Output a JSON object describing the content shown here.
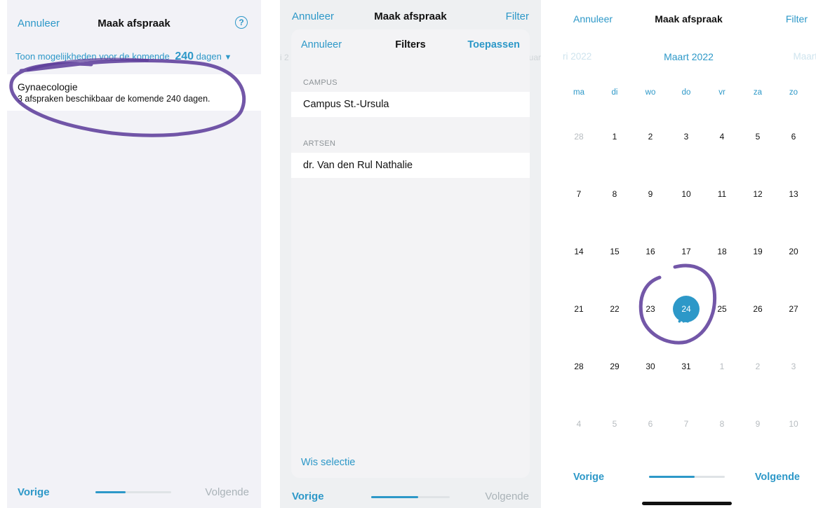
{
  "colors": {
    "accent": "#2d98c8",
    "annotation": "#5b3a99"
  },
  "screen1": {
    "nav": {
      "cancel": "Annuleer",
      "title": "Maak afspraak",
      "help_icon": "question-circle-icon",
      "help_glyph": "?"
    },
    "range": {
      "prefix": "Toon mogelijkheden voor de komende",
      "days": "240",
      "unit": "dagen",
      "caret": "▼"
    },
    "result": {
      "name": "Gynaecologie",
      "subtitle": "3 afspraken beschikbaar de komende 240 dagen."
    },
    "footer": {
      "prev": "Vorige",
      "next": "Volgende",
      "progress": 0.4
    }
  },
  "screen2": {
    "nav": {
      "cancel": "Annuleer",
      "title": "Maak afspraak",
      "filter": "Filter"
    },
    "peek": {
      "left": "i 2",
      "right": "uar"
    },
    "sheet": {
      "cancel": "Annuleer",
      "title": "Filters",
      "apply": "Toepassen",
      "sections": [
        {
          "label": "CAMPUS",
          "value": "Campus St.-Ursula"
        },
        {
          "label": "ARTSEN",
          "value": "dr. Van den Rul Nathalie"
        }
      ],
      "clear": "Wis selectie"
    },
    "footer": {
      "prev": "Vorige",
      "next": "Volgende",
      "progress": 0.6
    }
  },
  "screen3": {
    "nav": {
      "cancel": "Annuleer",
      "title": "Maak afspraak",
      "filter": "Filter"
    },
    "months": {
      "prev": "ri 2022",
      "current": "Maart 2022",
      "next": "Maart"
    },
    "weekdays": [
      "ma",
      "di",
      "wo",
      "do",
      "vr",
      "za",
      "zo"
    ],
    "weeks": [
      [
        [
          "28",
          true
        ],
        [
          "1",
          false
        ],
        [
          "2",
          false
        ],
        [
          "3",
          false
        ],
        [
          "4",
          false
        ],
        [
          "5",
          false
        ],
        [
          "6",
          false
        ]
      ],
      [
        [
          "7",
          false
        ],
        [
          "8",
          false
        ],
        [
          "9",
          false
        ],
        [
          "10",
          false
        ],
        [
          "11",
          false
        ],
        [
          "12",
          false
        ],
        [
          "13",
          false
        ]
      ],
      [
        [
          "14",
          false
        ],
        [
          "15",
          false
        ],
        [
          "16",
          false
        ],
        [
          "17",
          false
        ],
        [
          "18",
          false
        ],
        [
          "19",
          false
        ],
        [
          "20",
          false
        ]
      ],
      [
        [
          "21",
          false
        ],
        [
          "22",
          false
        ],
        [
          "23",
          false
        ],
        [
          "24",
          false
        ],
        [
          "25",
          false
        ],
        [
          "26",
          false
        ],
        [
          "27",
          false
        ]
      ],
      [
        [
          "28",
          false
        ],
        [
          "29",
          false
        ],
        [
          "30",
          false
        ],
        [
          "31",
          false
        ],
        [
          "1",
          true
        ],
        [
          "2",
          true
        ],
        [
          "3",
          true
        ]
      ],
      [
        [
          "4",
          true
        ],
        [
          "5",
          true
        ],
        [
          "6",
          true
        ],
        [
          "7",
          true
        ],
        [
          "8",
          true
        ],
        [
          "9",
          true
        ],
        [
          "10",
          true
        ]
      ]
    ],
    "selected": {
      "week": 3,
      "day": 3,
      "label": "24",
      "indicator": "•••"
    },
    "footer": {
      "prev": "Vorige",
      "next": "Volgende",
      "progress": 0.6
    }
  }
}
